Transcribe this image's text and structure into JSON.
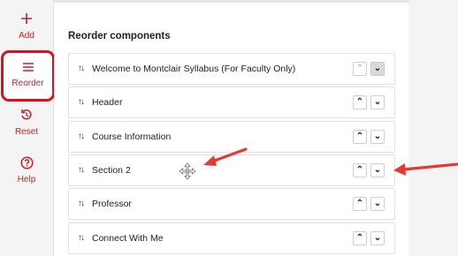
{
  "sidebar": {
    "items": [
      {
        "label": "Add",
        "icon": "plus-icon"
      },
      {
        "label": "Reorder",
        "icon": "list-icon"
      },
      {
        "label": "Reset",
        "icon": "reset-icon"
      },
      {
        "label": "Help",
        "icon": "help-icon"
      }
    ]
  },
  "main": {
    "title": "Reorder components",
    "components": [
      {
        "label": "Welcome to Montclair Syllabus (For Faculty Only)"
      },
      {
        "label": "Header"
      },
      {
        "label": "Course Information"
      },
      {
        "label": "Section 2"
      },
      {
        "label": "Professor"
      },
      {
        "label": "Connect With Me"
      }
    ],
    "move_up_glyph": "⌃",
    "move_down_glyph": "⌄"
  },
  "colors": {
    "accent": "#c8202a",
    "highlight_border": "#e00d1d",
    "annotation_arrow": "#e53935"
  }
}
